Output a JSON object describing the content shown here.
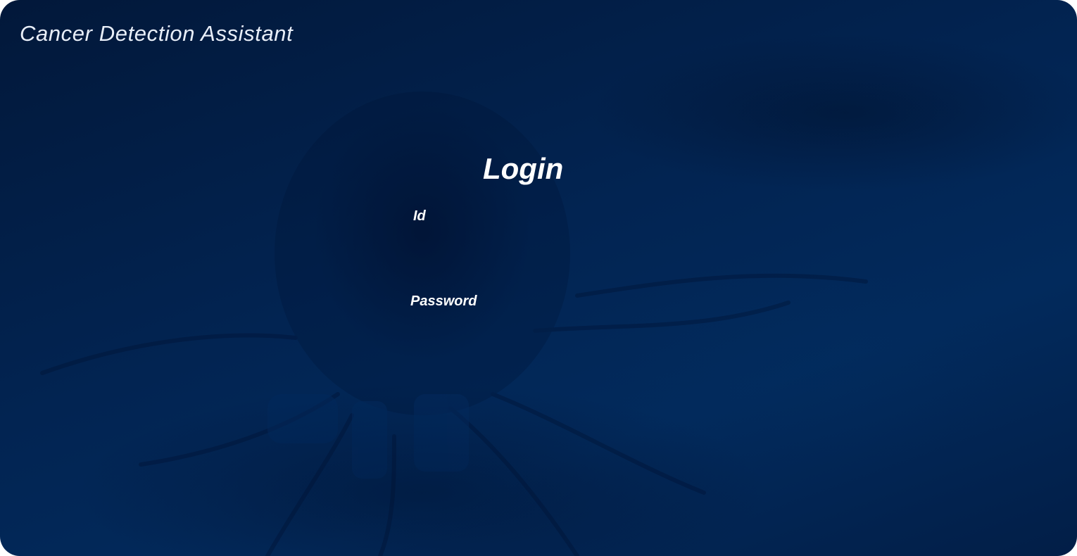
{
  "app": {
    "title": "Cancer Detection Assistant"
  },
  "login": {
    "heading": "Login",
    "id_label": "Id",
    "id_value": "",
    "password_label": "Password",
    "password_value": ""
  },
  "colors": {
    "background_dark": "#02183a",
    "background_mid": "#022452",
    "text": "#ffffff"
  }
}
